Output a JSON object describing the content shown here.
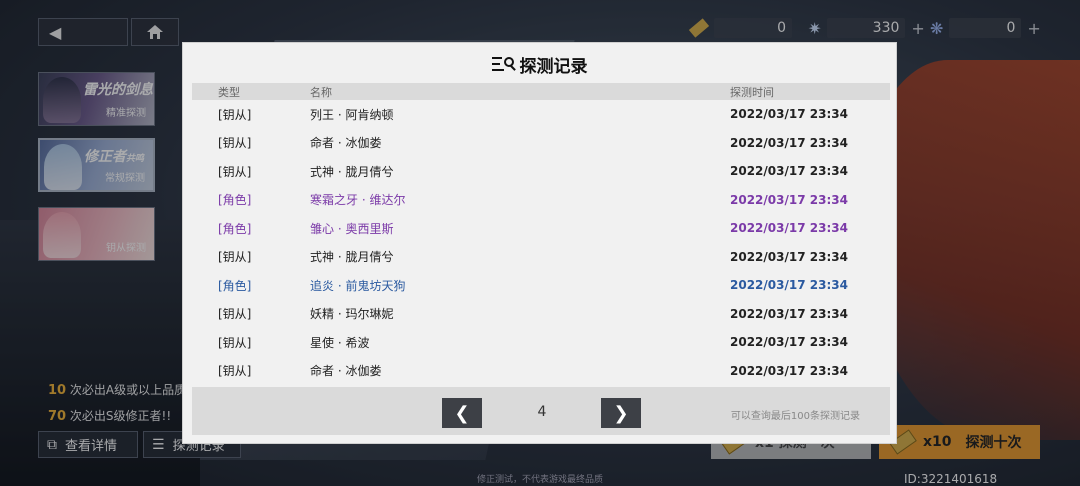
{
  "currencies": [
    {
      "value": "0",
      "icon": "ticket-icon"
    },
    {
      "value": "330",
      "icon": "crystal-icon",
      "plus": "+"
    },
    {
      "value": "0",
      "icon": "star-shard-icon",
      "plus": "+"
    }
  ],
  "banners": [
    {
      "title": "雷光的剑息",
      "sub": "精准探测"
    },
    {
      "title": "修正者",
      "tag": "共鸣",
      "sub": "常规探测"
    },
    {
      "title": "",
      "sub": "钥从探测"
    }
  ],
  "info": {
    "line1_num": "10",
    "line1_text": " 次必出A级或以上品质修正者!",
    "line2_num": "70",
    "line2_text": " 次必出S级修正者!!"
  },
  "buttons": {
    "details": "查看详情",
    "records": "探测记录",
    "draw1": "x1   探测一次",
    "draw10_count": "x10",
    "draw10": "探测十次"
  },
  "footer": "修正测试，不代表游戏最终品质",
  "player_id": "ID:3221401618",
  "modal": {
    "title": "探测记录",
    "headers": {
      "type": "类型",
      "name": "名称",
      "time": "探测时间"
    },
    "rows": [
      {
        "type": "[钥从]",
        "name": "列王 · 阿肯纳顿",
        "time": "2022/03/17 23:34",
        "color": "default"
      },
      {
        "type": "[钥从]",
        "name": "命者 · 冰伽娄",
        "time": "2022/03/17 23:34",
        "color": "default"
      },
      {
        "type": "[钥从]",
        "name": "式神 · 胧月倩兮",
        "time": "2022/03/17 23:34",
        "color": "default"
      },
      {
        "type": "[角色]",
        "name": "寒霜之牙 · 维达尔",
        "time": "2022/03/17 23:34",
        "color": "purple"
      },
      {
        "type": "[角色]",
        "name": "雏心 · 奥西里斯",
        "time": "2022/03/17 23:34",
        "color": "purple"
      },
      {
        "type": "[钥从]",
        "name": "式神 · 胧月倩兮",
        "time": "2022/03/17 23:34",
        "color": "default"
      },
      {
        "type": "[角色]",
        "name": "追炎 · 前鬼坊天狗",
        "time": "2022/03/17 23:34",
        "color": "blue"
      },
      {
        "type": "[钥从]",
        "name": "妖精 · 玛尔琳妮",
        "time": "2022/03/17 23:34",
        "color": "default"
      },
      {
        "type": "[钥从]",
        "name": "星使 · 希波",
        "time": "2022/03/17 23:34",
        "color": "default"
      },
      {
        "type": "[钥从]",
        "name": "命者 · 冰伽娄",
        "time": "2022/03/17 23:34",
        "color": "default"
      }
    ],
    "page": "4",
    "prev": "❮",
    "next": "❯",
    "note": "可以查询最后100条探测记录"
  }
}
